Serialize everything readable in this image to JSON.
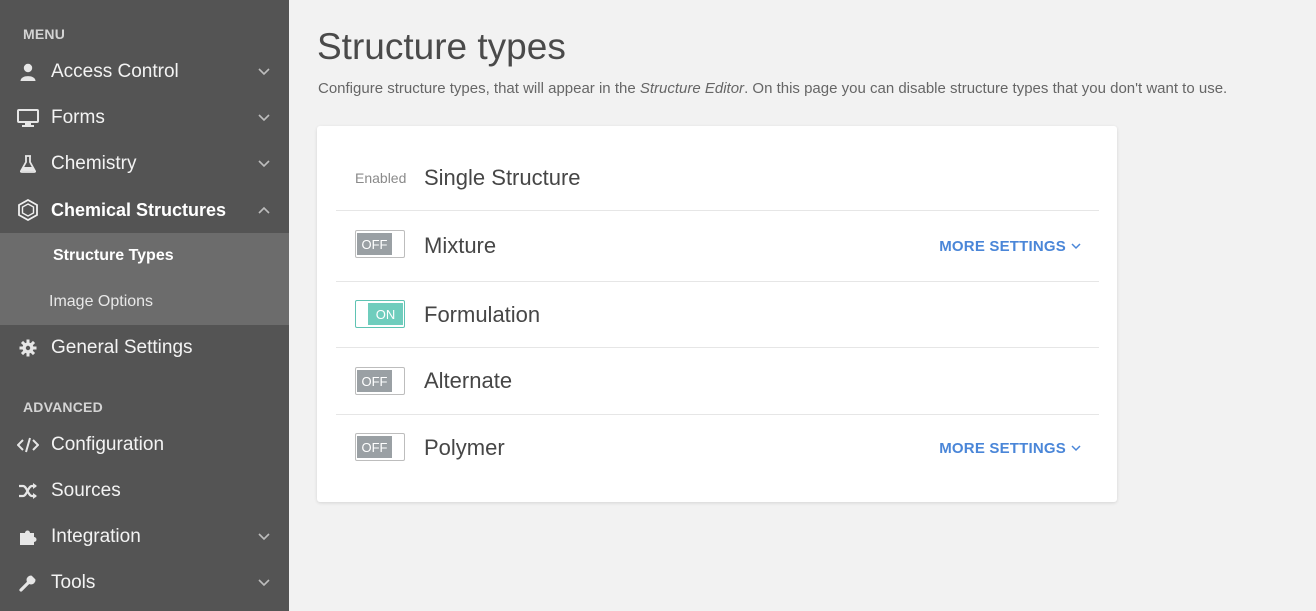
{
  "sidebar": {
    "menu_label": "MENU",
    "advanced_label": "ADVANCED",
    "items": [
      {
        "label": "Access Control",
        "icon": "user-icon"
      },
      {
        "label": "Forms",
        "icon": "monitor-icon"
      },
      {
        "label": "Chemistry",
        "icon": "flask-icon"
      },
      {
        "label": "Chemical Structures",
        "icon": "hexagon-icon"
      },
      {
        "label": "General Settings",
        "icon": "gear-icon"
      },
      {
        "label": "Configuration",
        "icon": "code-icon"
      },
      {
        "label": "Sources",
        "icon": "shuffle-icon"
      },
      {
        "label": "Integration",
        "icon": "puzzle-icon"
      },
      {
        "label": "Tools",
        "icon": "wrench-icon"
      }
    ],
    "submenu": [
      {
        "label": "Structure Types"
      },
      {
        "label": "Image Options"
      }
    ]
  },
  "main": {
    "title": "Structure types",
    "description_prefix": "Configure structure types, that will appear in the ",
    "description_em": "Structure Editor",
    "description_suffix": ". On this page you can disable structure types that you don't want to use.",
    "enabled_label": "Enabled",
    "more_settings_label": "MORE SETTINGS",
    "rows": [
      {
        "name": "Single Structure",
        "state": "Enabled"
      },
      {
        "name": "Mixture",
        "state": "OFF"
      },
      {
        "name": "Formulation",
        "state": "ON"
      },
      {
        "name": "Alternate",
        "state": "OFF"
      },
      {
        "name": "Polymer",
        "state": "OFF"
      }
    ]
  },
  "colors": {
    "sidebar_bg": "#545454",
    "submenu_bg": "#6c6c6c",
    "accent_link": "#4a86d8",
    "toggle_on": "#6fcdbd",
    "toggle_off": "#9aa0a4"
  }
}
